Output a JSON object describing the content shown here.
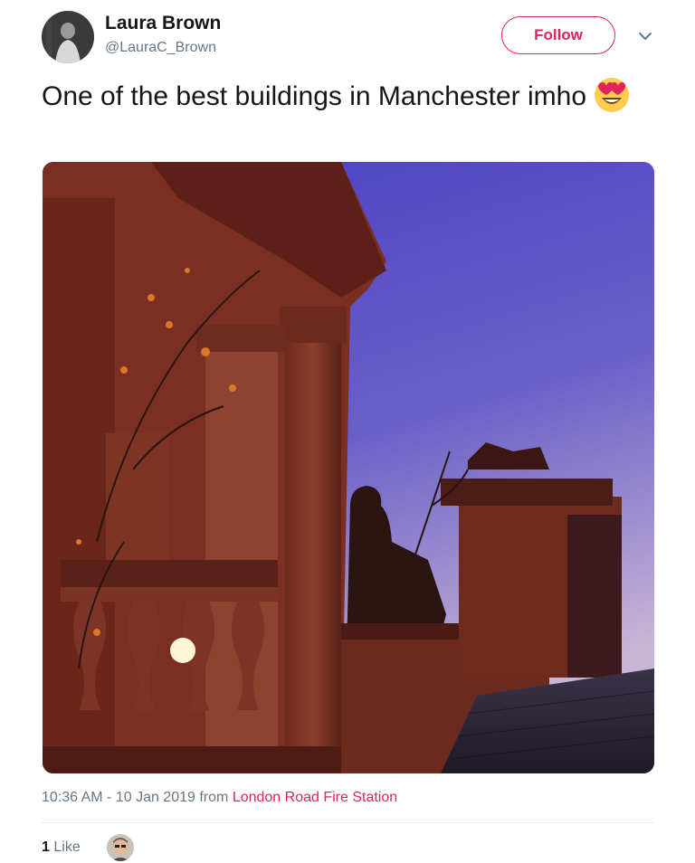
{
  "user": {
    "name": "Laura Brown",
    "handle": "@LauraC_Brown",
    "follow_label": "Follow"
  },
  "tweet": {
    "text": "One of the best buildings in Manchester imho",
    "emoji": "smiling-face-with-heart-eyes"
  },
  "photo": {
    "subject": "building-silhouette-against-sky"
  },
  "meta": {
    "time_date": "10:36 AM - 10 Jan 2019",
    "from_word": "from",
    "location": "London Road Fire Station"
  },
  "likes": {
    "count": "1",
    "label": "Like"
  },
  "colors": {
    "accent": "#e0245e",
    "secondary_text": "#657786",
    "divider": "#e6ecf0"
  }
}
